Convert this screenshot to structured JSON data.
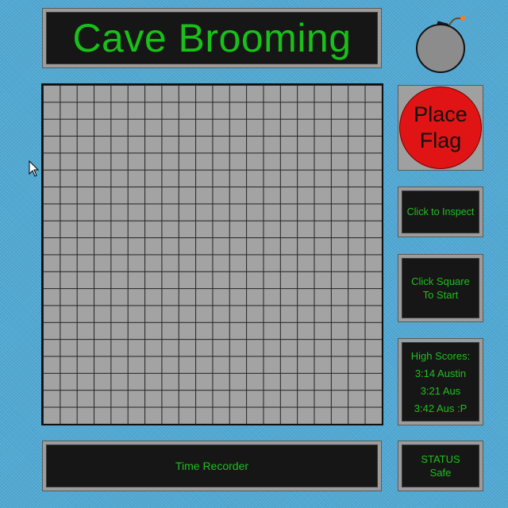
{
  "title": "Cave Brooming",
  "board": {
    "rows": 20,
    "cols": 20
  },
  "flag_button": {
    "line1": "Place",
    "line2": "Flag"
  },
  "inspect": {
    "label": "Click to Inspect"
  },
  "start": {
    "line1": "Click Square",
    "line2": "To Start"
  },
  "high_scores": {
    "heading": "High Scores:",
    "entries": [
      "3:14 Austin",
      "3:21 Aus",
      "3:42 Aus :P"
    ]
  },
  "timer": {
    "label": "Time Recorder"
  },
  "status": {
    "heading": "STATUS",
    "value": "Safe"
  },
  "colors": {
    "background": "#4fa8d3",
    "screen": "#161616",
    "text_green": "#1fbf1f",
    "flag_red": "#e01414",
    "cell_gray": "#a3a3a3"
  },
  "icons": {
    "bomb": "bomb-icon",
    "cursor": "mouse-pointer-icon"
  }
}
